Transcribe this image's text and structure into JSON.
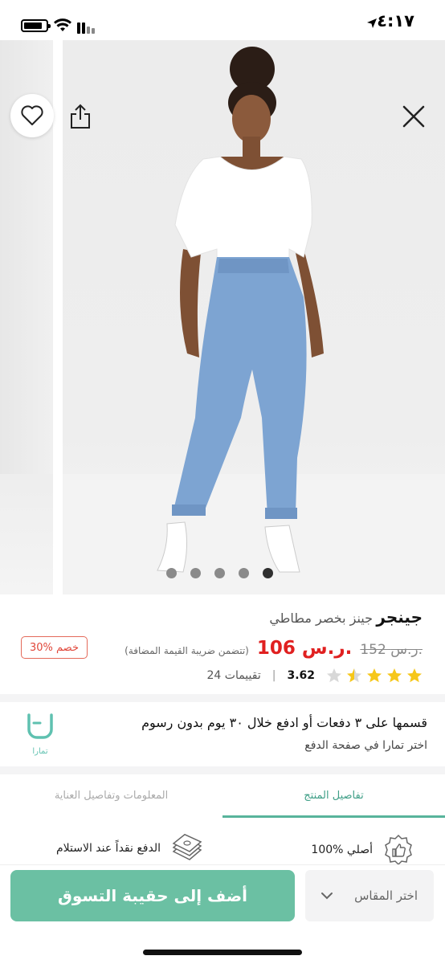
{
  "status_bar": {
    "time": "٤:١٧",
    "icons": [
      "location-arrow-icon",
      "battery-icon",
      "wifi-icon",
      "signal-icon"
    ]
  },
  "gallery": {
    "slide_count": 5,
    "active_slide": 5,
    "icons": [
      "heart-icon",
      "share-icon",
      "close-icon"
    ]
  },
  "product": {
    "brand": "جينجر",
    "name": "جينز بخصر مطاطي",
    "old_price": "152 ر.س.",
    "new_price": "106 ر.س.",
    "vat_note": "(تتضمن ضريبة القيمة المضافة)",
    "discount": "30% خصم",
    "rating": {
      "value": "3.62",
      "stars_filled": 3.5,
      "stars_total": 5,
      "count": "24 تقييمات"
    }
  },
  "tamara": {
    "title": "قسمها على ٣ دفعات أو ادفع خلال ٣٠ يوم بدون رسوم",
    "subtitle": "اختر تمارا في صفحة الدفع",
    "logo_text": "تمارا"
  },
  "tabs": {
    "details": "تفاصيل المنتج",
    "care": "المعلومات وتفاصيل العناية"
  },
  "features": {
    "original": "100% أصلي",
    "cod": "الدفع نقداً عند الاستلام"
  },
  "bottom_bar": {
    "add_to_bag": "أضف إلى حقيبة التسوق",
    "size_placeholder": "اختر المقاس"
  },
  "colors": {
    "accent_green": "#6bc0a3",
    "price_red": "#e02020",
    "star_yellow": "#f6c71a"
  }
}
